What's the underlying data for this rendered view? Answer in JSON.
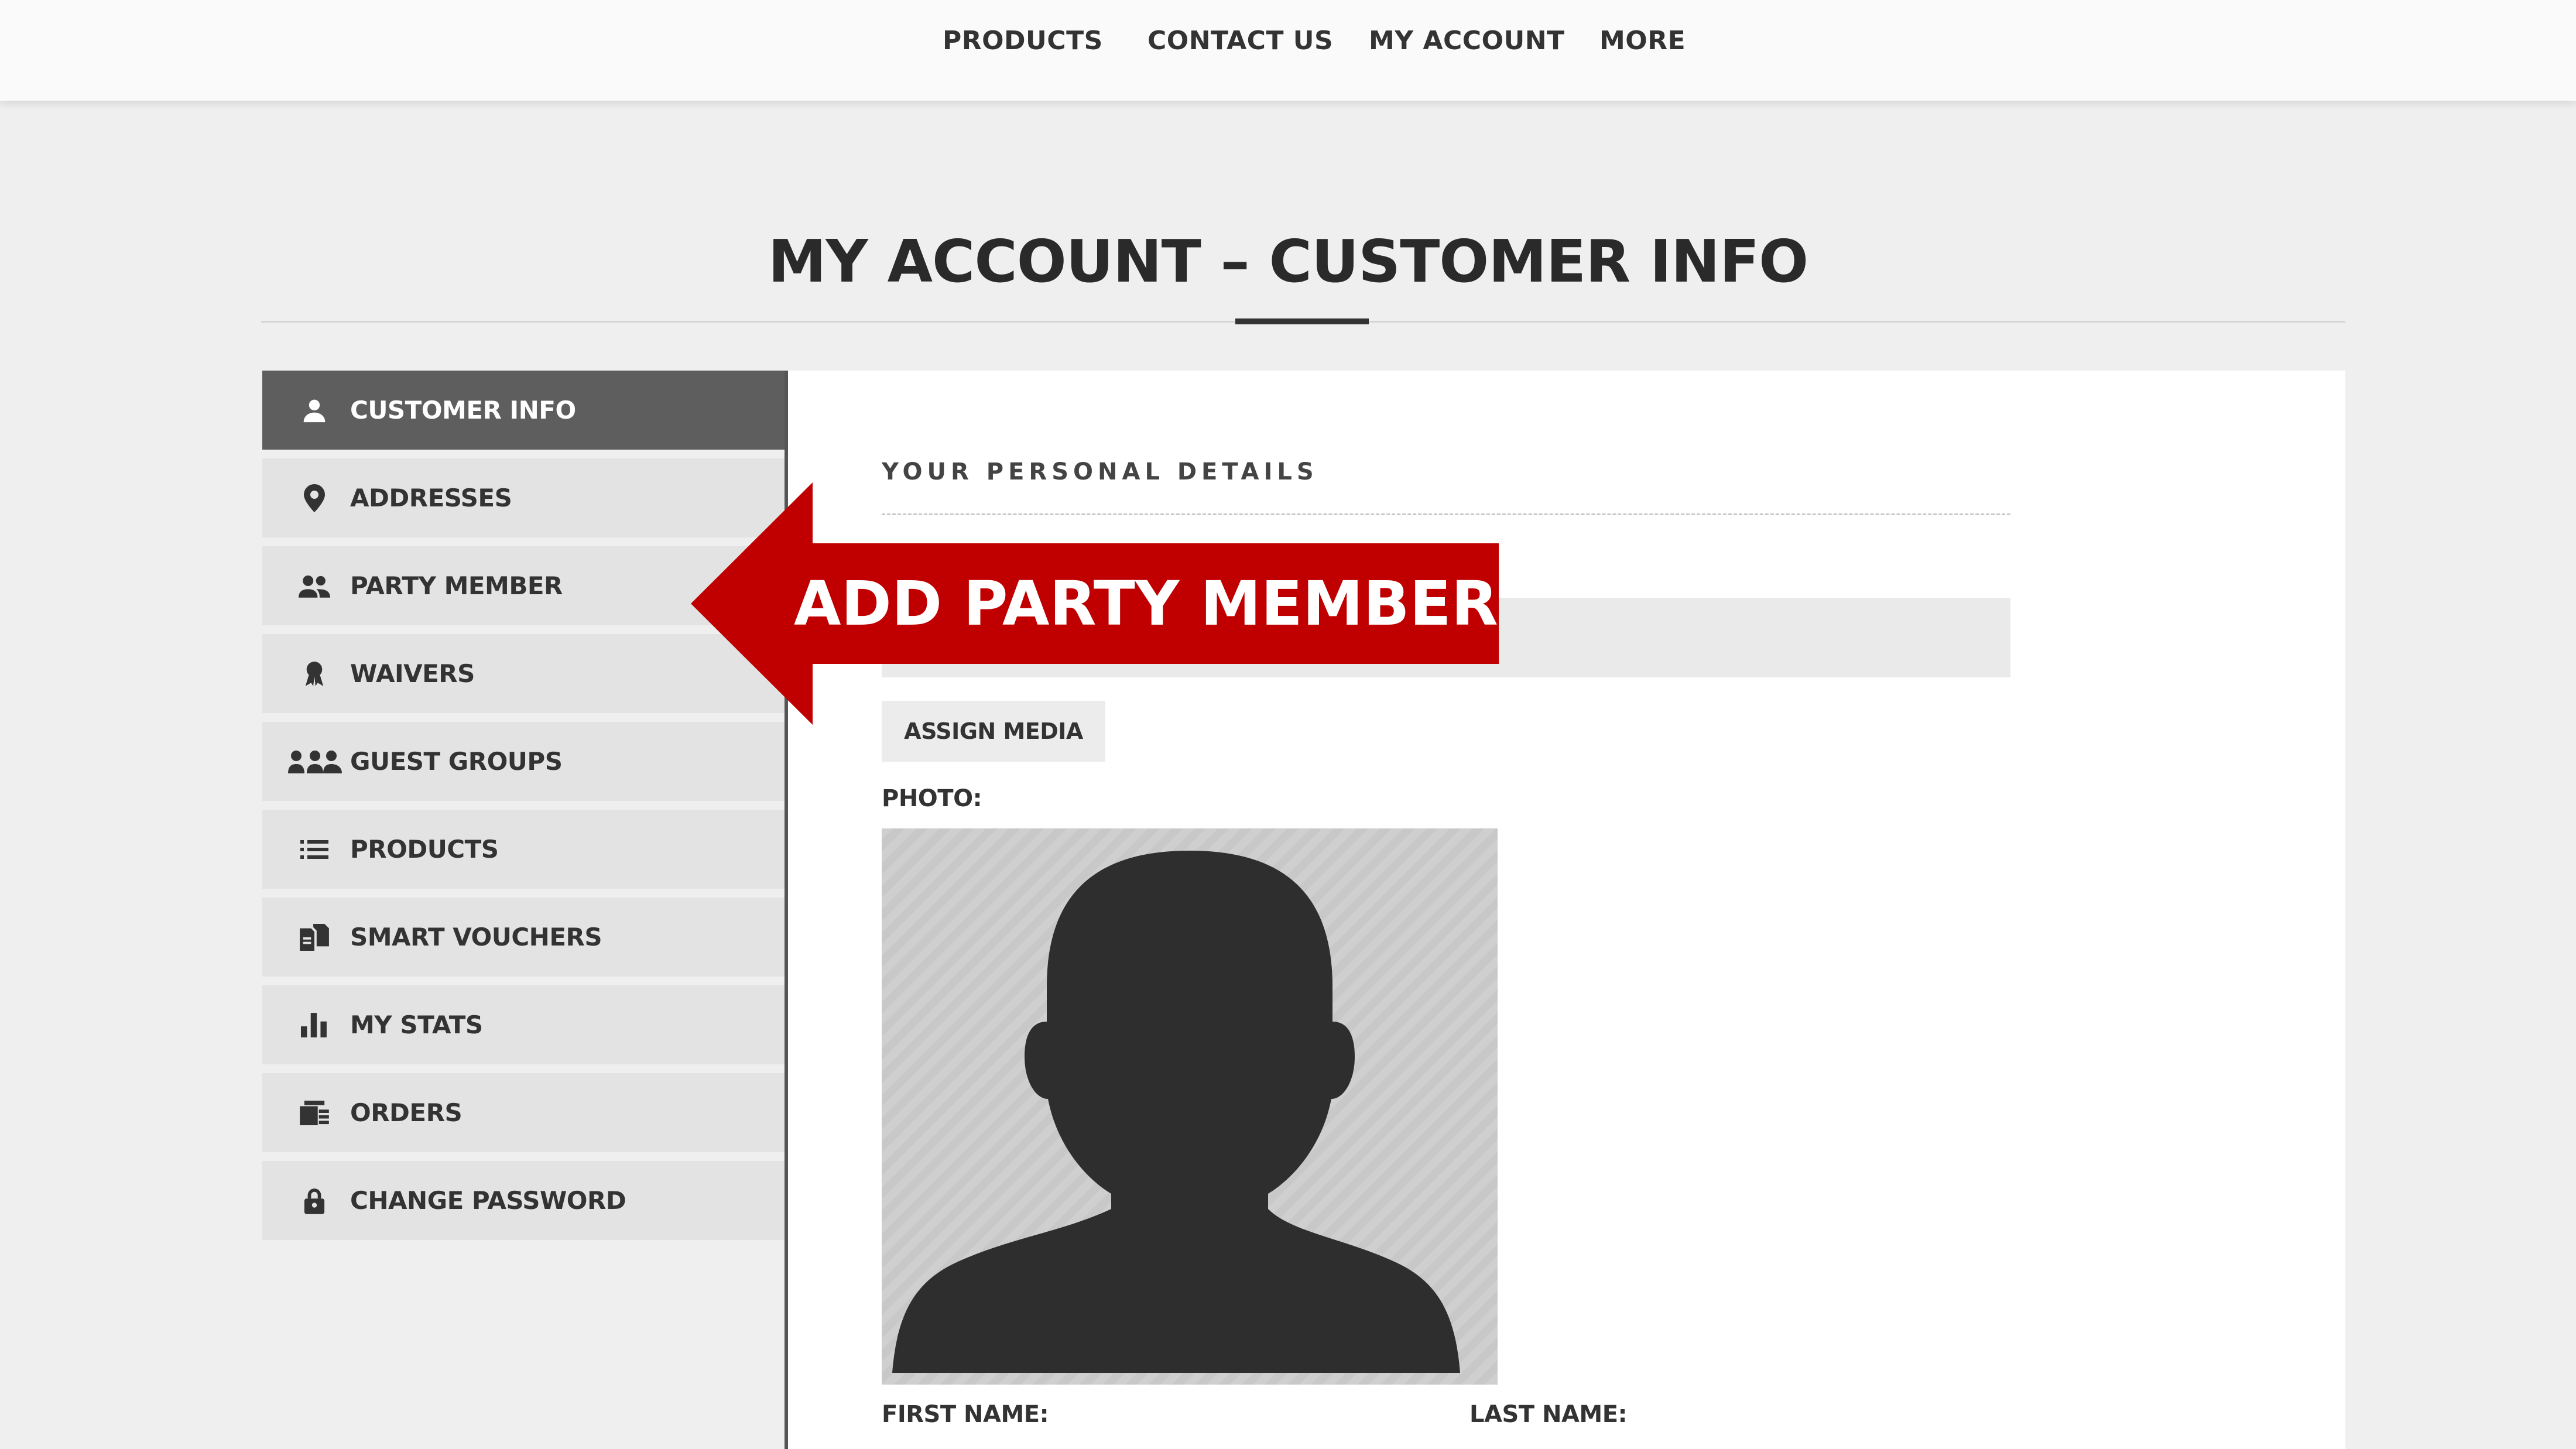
{
  "nav": {
    "items": [
      {
        "label": "PRODUCTS"
      },
      {
        "label": "CONTACT US"
      },
      {
        "label": "MY ACCOUNT"
      },
      {
        "label": "MORE"
      }
    ]
  },
  "page": {
    "title": "MY ACCOUNT – CUSTOMER INFO"
  },
  "sidebar": {
    "items": [
      {
        "label": "CUSTOMER INFO",
        "icon": "user-icon",
        "active": true
      },
      {
        "label": "ADDRESSES",
        "icon": "location-pin-icon"
      },
      {
        "label": "PARTY MEMBER",
        "icon": "two-users-icon"
      },
      {
        "label": "WAIVERS",
        "icon": "ribbon-badge-icon"
      },
      {
        "label": "GUEST GROUPS",
        "icon": "group-users-icon"
      },
      {
        "label": "PRODUCTS",
        "icon": "list-icon"
      },
      {
        "label": "SMART VOUCHERS",
        "icon": "voucher-documents-icon"
      },
      {
        "label": "MY STATS",
        "icon": "bar-chart-icon"
      },
      {
        "label": "ORDERS",
        "icon": "orders-icon"
      },
      {
        "label": "CHANGE PASSWORD",
        "icon": "lock-icon"
      }
    ]
  },
  "content": {
    "section_heading": "YOUR PERSONAL DETAILS",
    "assign_media_label": "ASSIGN MEDIA",
    "photo_label": "PHOTO:",
    "first_name_label": "FIRST NAME:",
    "last_name_label": "LAST NAME:"
  },
  "callout": {
    "text": "ADD PARTY MEMBER",
    "color": "#c00000"
  },
  "colors": {
    "active_sidebar_bg": "#5e5e5e",
    "sidebar_bg": "#e3e3e3",
    "page_bg": "#efefef"
  }
}
